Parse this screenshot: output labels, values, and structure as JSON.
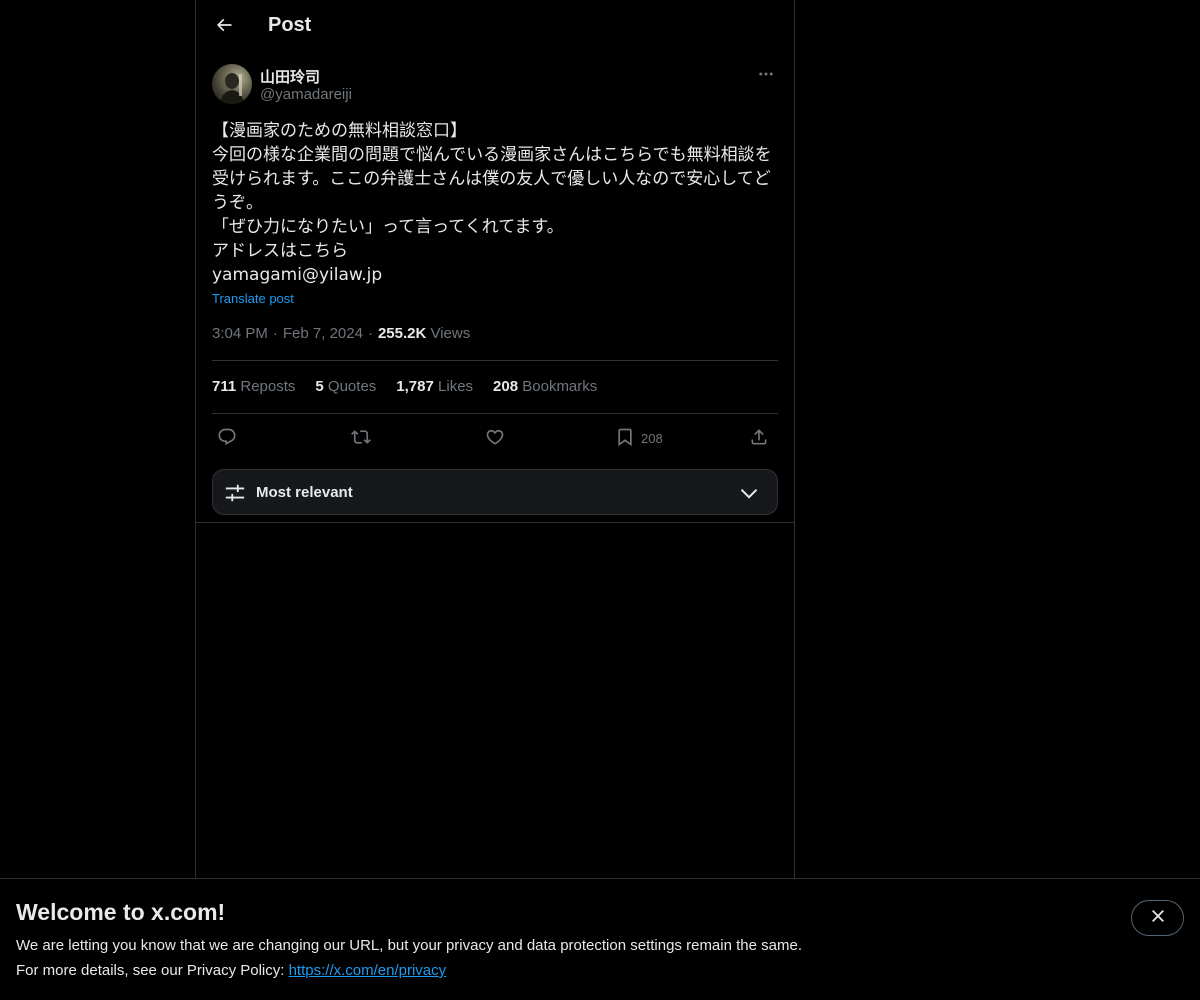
{
  "header": {
    "title": "Post",
    "back_icon": "arrow-left-icon"
  },
  "author": {
    "display_name": "山田玲司",
    "handle": "@yamadareiji",
    "more_icon": "more-horizontal-icon"
  },
  "post": {
    "text": "【漫画家のための無料相談窓口】\n今回の様な企業間の問題で悩んでいる漫画家さんはこちらでも無料相談を受けられます。ここの弁護士さんは僕の友人で優しい人なので安心してどうぞ。\n「ぜひ力になりたい」って言ってくれてます。\nアドレスはこちら\nyamagami@yilaw.jp",
    "translate_label": "Translate post",
    "time": "3:04 PM",
    "date": "Feb 7, 2024",
    "views_count": "255.2K",
    "views_label": "Views"
  },
  "stats": {
    "reposts_count": "711",
    "reposts_label": "Repost s",
    "quotes_count": "5",
    "quotes_label": "Quotes",
    "likes_count": "1,787",
    "likes_label": "Likes",
    "bookmarks_count": "208",
    "bookmarks_label": "Bookmarks"
  },
  "actions": {
    "reply_icon": "reply-icon",
    "repost_icon": "repost-icon",
    "like_icon": "heart-icon",
    "bookmark_icon": "bookmark-icon",
    "bookmark_count": "208",
    "share_icon": "share-icon"
  },
  "sort": {
    "label": "Most relevant"
  },
  "banner": {
    "title": "Welcome to x.com!",
    "line1": "We are letting you know that we are changing our URL, but your privacy and data protection settings remain the same.",
    "line2_prefix": "For more details, see our Privacy Policy: ",
    "link": "https://x.com/en/privacy"
  },
  "colors": {
    "accent": "#1d9bf0",
    "background": "#000000",
    "border": "#2f3336",
    "muted": "#71767b",
    "text": "#e7e9ea"
  }
}
